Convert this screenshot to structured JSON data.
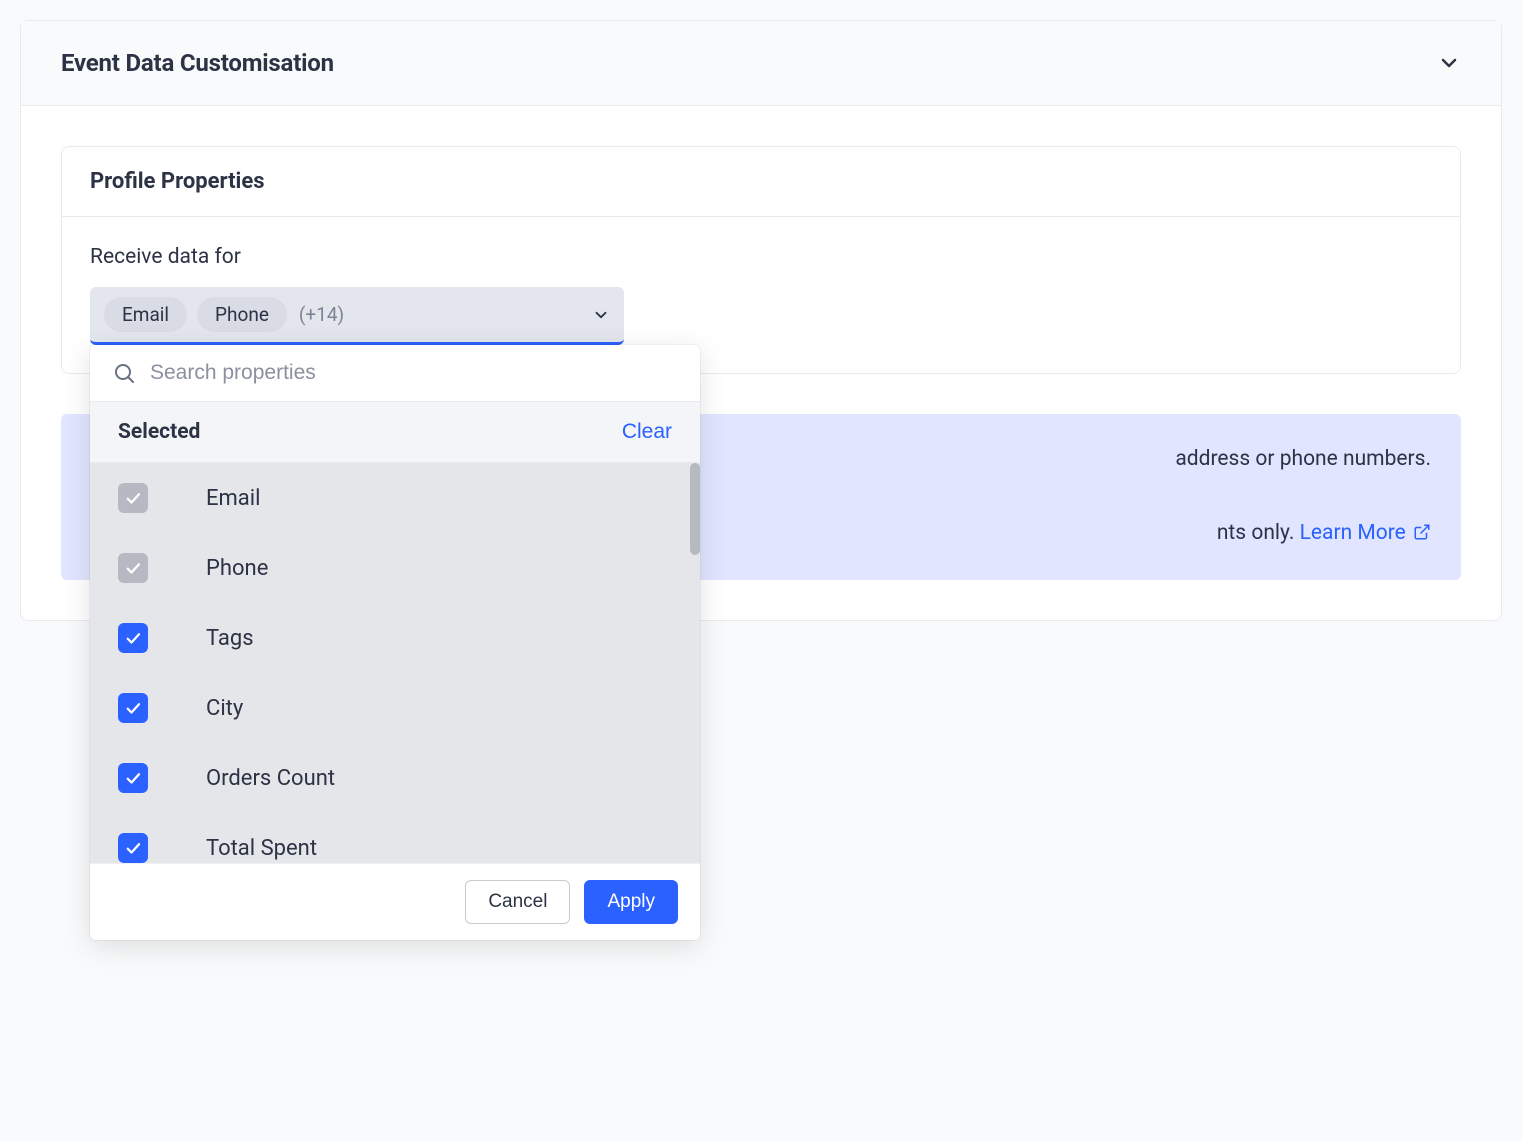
{
  "panel": {
    "title": "Event Data Customisation"
  },
  "profile": {
    "heading": "Profile Properties",
    "field_label": "Receive data for",
    "chips": [
      "Email",
      "Phone"
    ],
    "more_count": "(+14)"
  },
  "dropdown": {
    "search_placeholder": "Search properties",
    "selected_label": "Selected",
    "clear_label": "Clear",
    "items": [
      {
        "label": "Email",
        "locked": true
      },
      {
        "label": "Phone",
        "locked": true
      },
      {
        "label": "Tags",
        "locked": false
      },
      {
        "label": "City",
        "locked": false
      },
      {
        "label": "Orders Count",
        "locked": false
      },
      {
        "label": "Total Spent",
        "locked": false
      }
    ],
    "cancel_label": "Cancel",
    "apply_label": "Apply"
  },
  "banner": {
    "line1_suffix": "address or phone numbers.",
    "line2_suffix": "nts only. ",
    "learn_more": "Learn More"
  }
}
